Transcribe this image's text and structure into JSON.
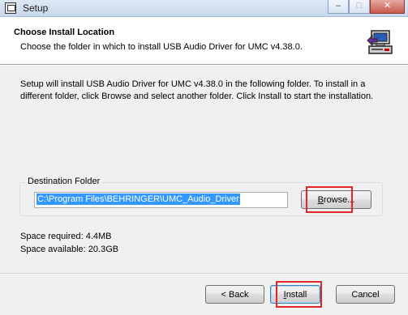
{
  "window": {
    "title": "Setup",
    "minimize_symbol": "–",
    "maximize_symbol": "□",
    "close_symbol": "✕"
  },
  "header": {
    "title": "Choose Install Location",
    "subtitle": "Choose the folder in which to install USB Audio Driver for UMC v4.38.0."
  },
  "body": {
    "description": "Setup will install USB Audio Driver for UMC v4.38.0 in the following folder. To install in a different folder, click Browse and select another folder. Click Install to start the installation.",
    "destination_group_label": "Destination Folder",
    "destination_path": "C:\\Program Files\\BEHRINGER\\UMC_Audio_Driver",
    "browse_prefix": "",
    "browse_underlined": "B",
    "browse_suffix": "rowse...",
    "space_required": "Space required: 4.4MB",
    "space_available": "Space available: 20.3GB"
  },
  "footer": {
    "back_label": "< Back",
    "install_underlined": "I",
    "install_suffix": "nstall",
    "cancel_label": "Cancel"
  },
  "colors": {
    "selection": "#3399ff",
    "highlight_annotation": "#e0262a"
  }
}
